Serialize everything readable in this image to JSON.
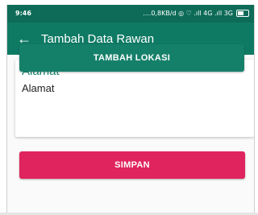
{
  "status_bar": {
    "time": "9:46",
    "indicators": "....0,8KB/d ◎ ♡ .ıll 4G .ıll 3G",
    "battery_level": 0.6
  },
  "app_bar": {
    "back_icon": "arrow-left-icon",
    "title": "Tambah Data Rawan"
  },
  "form": {
    "address_label": "Alamat",
    "address_value": "Alamat",
    "add_location_button": "TAMBAH LOKASI",
    "save_button": "SIMPAN"
  },
  "colors": {
    "primary": "#0f7a64",
    "status_bar": "#0d6b58",
    "accent_label": "#1a8a74",
    "save_button": "#e0245e"
  }
}
